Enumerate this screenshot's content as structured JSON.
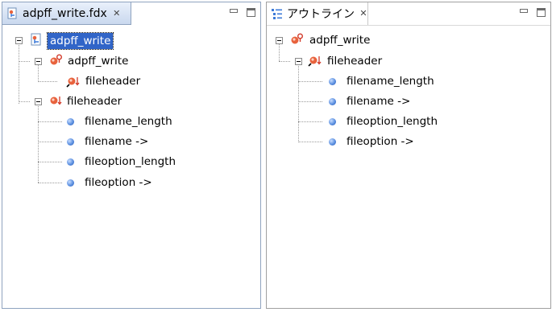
{
  "left_panel": {
    "tab_title": "adpff_write.fdx",
    "tab_icon": "fdx-file-icon",
    "tree": {
      "root": "adpff_write",
      "section1": "adpff_write",
      "section1_child": "fileheader",
      "section2": "fileheader",
      "fields": [
        "filename_length",
        "filename ->",
        "fileoption_length",
        "fileoption ->"
      ]
    }
  },
  "right_panel": {
    "tab_title": "アウトライン",
    "tab_icon": "outline-icon",
    "tree": {
      "root": "adpff_write",
      "section": "fileheader",
      "fields": [
        "filename_length",
        "filename ->",
        "fileoption_length",
        "fileoption ->"
      ]
    }
  },
  "colors": {
    "selection": "#3165c8",
    "field_dot": "#5b8fe0",
    "structure_icon": "#e8623c"
  }
}
